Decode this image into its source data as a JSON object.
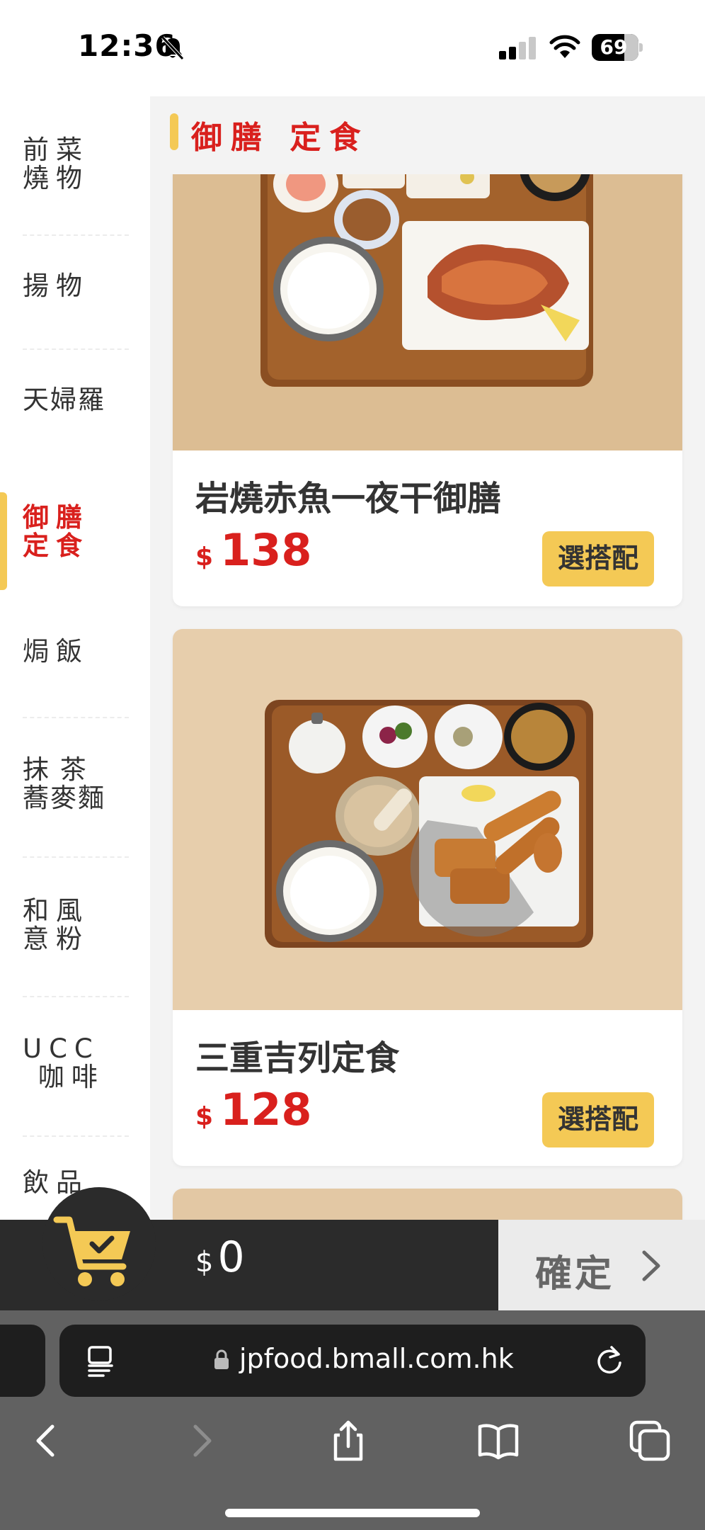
{
  "status_bar": {
    "time": "12:36",
    "battery": "69"
  },
  "colors": {
    "accent_red": "#d9201d",
    "accent_yellow": "#f4c955",
    "cart_bar": "#2b2b2b",
    "browser_chrome": "#616161"
  },
  "sidebar": {
    "items": [
      {
        "label": "前菜\n燒物",
        "active": false
      },
      {
        "label": "揚物",
        "active": false
      },
      {
        "label": "天婦羅",
        "active": false
      },
      {
        "label": "御膳\n定食",
        "active": true
      },
      {
        "label": "焗飯",
        "active": false
      },
      {
        "label": "抹 茶\n蕎麥麵",
        "active": false
      },
      {
        "label": "和風\n意粉",
        "active": false
      },
      {
        "label": "UCC\n 咖啡",
        "active": false
      },
      {
        "label": "飲品",
        "active": false
      }
    ]
  },
  "section": {
    "title": "御膳 定食"
  },
  "products": [
    {
      "name": "岩燒赤魚一夜干御膳",
      "currency": "$",
      "price": "138",
      "option_label": "選搭配",
      "photo_icon": "grilled-fish-set-photo"
    },
    {
      "name": "三重吉列定食",
      "currency": "$",
      "price": "128",
      "option_label": "選搭配",
      "photo_icon": "katsu-set-photo"
    }
  ],
  "cart": {
    "currency": "$",
    "total": "0",
    "confirm_label": "確定",
    "icon": "cart-check-icon"
  },
  "browser": {
    "url": "jpfood.bmall.com.hk"
  }
}
